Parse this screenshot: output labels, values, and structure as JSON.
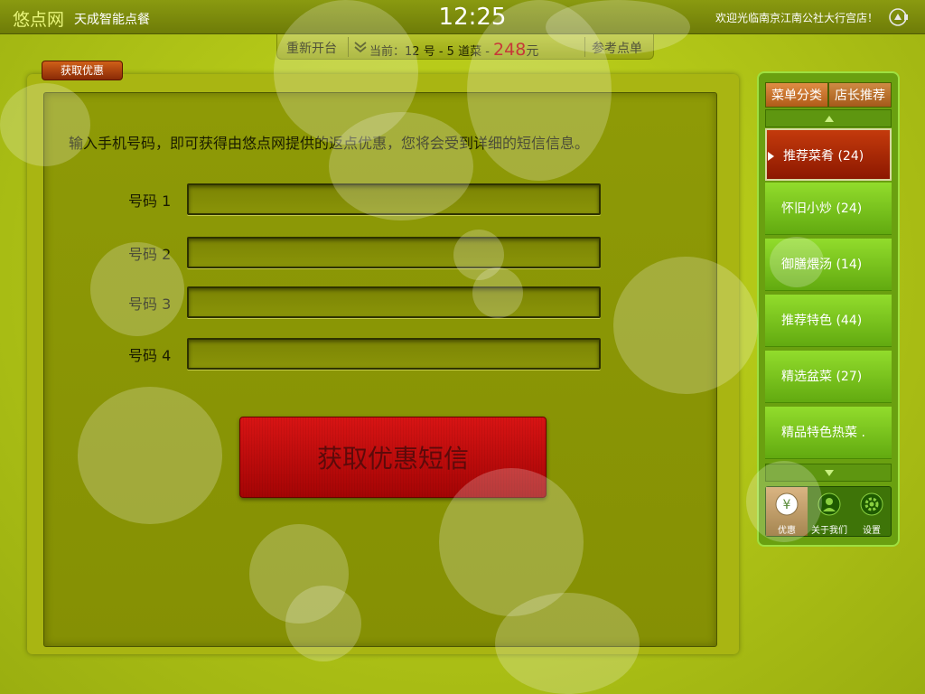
{
  "app": {
    "logo": "悠点网",
    "subtitle": "天成智能点餐",
    "clock": "12:25",
    "welcome": "欢迎光临南京江南公社大行宫店！"
  },
  "order_bar": {
    "reset_label": "重新开台",
    "current_prefix": "当前：",
    "table_number": "12 号",
    "dash1": " - ",
    "dish_count": "5 道菜",
    "dash2": " - ",
    "price": "248",
    "currency": "元",
    "reference_menu_label": "参考点单"
  },
  "tab": {
    "label": "获取优惠"
  },
  "form": {
    "instruction": "输入手机号码，即可获得由悠点网提供的返点优惠，您将会受到详细的短信信息。",
    "fields": [
      {
        "label": "号码 1",
        "value": ""
      },
      {
        "label": "号码 2",
        "value": ""
      },
      {
        "label": "号码 3",
        "value": ""
      },
      {
        "label": "号码 4",
        "value": ""
      }
    ],
    "submit_label": "获取优惠短信"
  },
  "sidebar": {
    "tabs": [
      {
        "label": "菜单分类",
        "active": true
      },
      {
        "label": "店长推荐",
        "active": false
      }
    ],
    "categories": [
      {
        "label": "推荐菜肴 (24)",
        "active": true
      },
      {
        "label": "怀旧小炒 (24)",
        "active": false
      },
      {
        "label": "御膳煨汤 (14)",
        "active": false
      },
      {
        "label": "推荐特色 (44)",
        "active": false
      },
      {
        "label": "精选盆菜 (27)",
        "active": false
      },
      {
        "label": "精品特色热菜 .",
        "active": false
      }
    ],
    "bottom_nav": [
      {
        "label": "优惠",
        "icon": "yen-coin-icon",
        "active": true
      },
      {
        "label": "关于我们",
        "icon": "user-icon",
        "active": false
      },
      {
        "label": "设置",
        "icon": "gear-icon",
        "active": false
      }
    ]
  },
  "colors": {
    "background": "#b4c818",
    "accent_red": "#c80c0c",
    "price_red": "#b80000",
    "menu_green": "#7cc81e",
    "tab_orange": "#d07a30"
  }
}
